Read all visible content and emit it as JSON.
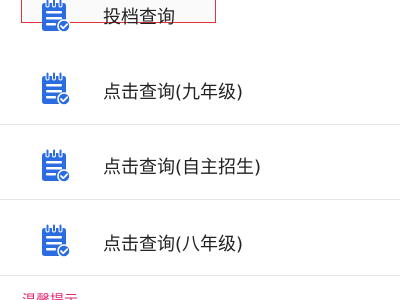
{
  "menu": {
    "items": [
      {
        "label": "投档查询",
        "icon": "document-check-icon",
        "selected": true
      },
      {
        "label": "点击查询(九年级)",
        "icon": "document-check-icon"
      },
      {
        "label": "点击查询(自主招生)",
        "icon": "document-check-icon"
      },
      {
        "label": "点击查询(八年级)",
        "icon": "document-check-icon"
      }
    ]
  },
  "footer": {
    "link_text": "温馨提示"
  },
  "colors": {
    "icon_blue": "#2b6de0",
    "icon_check": "#ffffff",
    "selected_border": "#e0343a",
    "footer_link": "#e0266e",
    "text": "#222222",
    "divider": "#e6e6e6"
  }
}
